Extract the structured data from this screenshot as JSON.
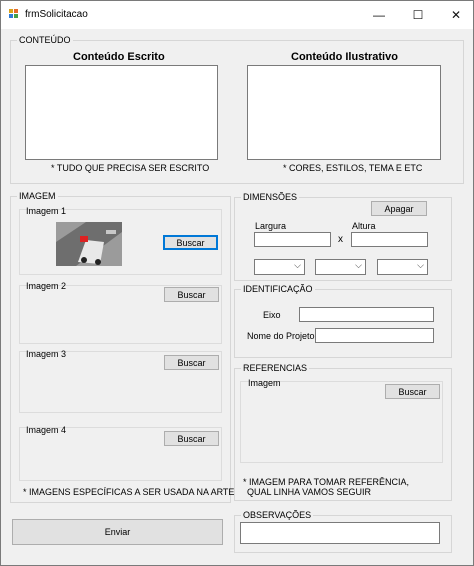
{
  "window": {
    "title": "frmSolicitacao",
    "controls": {
      "minimize": "—",
      "maximize": "☐",
      "close": "✕"
    }
  },
  "conteudo": {
    "group_label": "CONTEÚDO",
    "escrito_title": "Conteúdo Escrito",
    "ilustrativo_title": "Conteúdo Ilustrativo",
    "escrito_note": "* TUDO QUE PRECISA SER ESCRITO",
    "ilustrativo_note": "* CORES, ESTILOS, TEMA E ETC"
  },
  "imagem": {
    "group_label": "IMAGEM",
    "items": [
      {
        "label": "Imagem 1",
        "button": "Buscar"
      },
      {
        "label": "Imagem 2",
        "button": "Buscar"
      },
      {
        "label": "Imagem 3",
        "button": "Buscar"
      },
      {
        "label": "Imagem 4",
        "button": "Buscar"
      }
    ],
    "note": "* IMAGENS ESPECÍFICAS A SER USADA NA ARTE"
  },
  "dimensoes": {
    "group_label": "DIMENSÕES",
    "clear_button": "Apagar",
    "largura_label": "Largura",
    "altura_label": "Altura",
    "separator": "x"
  },
  "identificacao": {
    "group_label": "IDENTIFICAÇÃO",
    "eixo_label": "Eixo",
    "projeto_label": "Nome do Projeto"
  },
  "referencias": {
    "group_label": "REFERENCIAS",
    "imagem_label": "Imagem",
    "button": "Buscar",
    "note_line1": "* IMAGEM PARA TOMAR REFERÊNCIA,",
    "note_line2": "QUAL LINHA VAMOS SEGUIR"
  },
  "observacoes": {
    "group_label": "OBSERVAÇÕES"
  },
  "submit_button": "Enviar",
  "combo_arrow": "⌵"
}
